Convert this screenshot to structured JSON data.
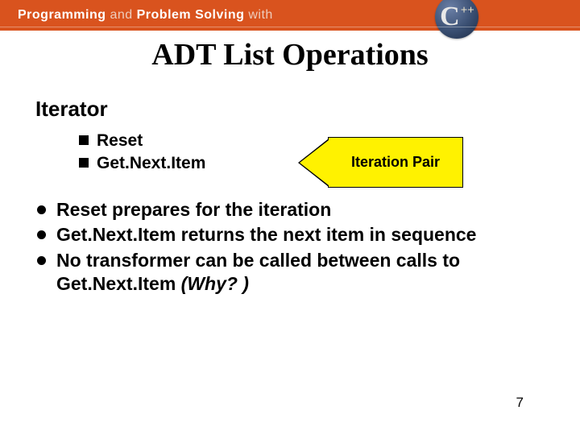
{
  "banner": {
    "word_programming": "Programming",
    "word_and": "and",
    "word_problem": "Problem",
    "word_solving": "Solving",
    "word_with": "with",
    "cpp_c": "C",
    "cpp_pp": "++"
  },
  "title": "ADT List Operations",
  "section_heading": "Iterator",
  "iterator_items": {
    "0": "Reset",
    "1": "Get.Next.Item"
  },
  "callout_label": "Iteration Pair",
  "bullets": {
    "0": "Reset prepares for the iteration",
    "1": "Get.Next.Item returns the next item in sequence",
    "2_prefix": "No transformer can be called between calls to Get.Next.Item ",
    "2_why": " (Why? )"
  },
  "page_number": "7"
}
